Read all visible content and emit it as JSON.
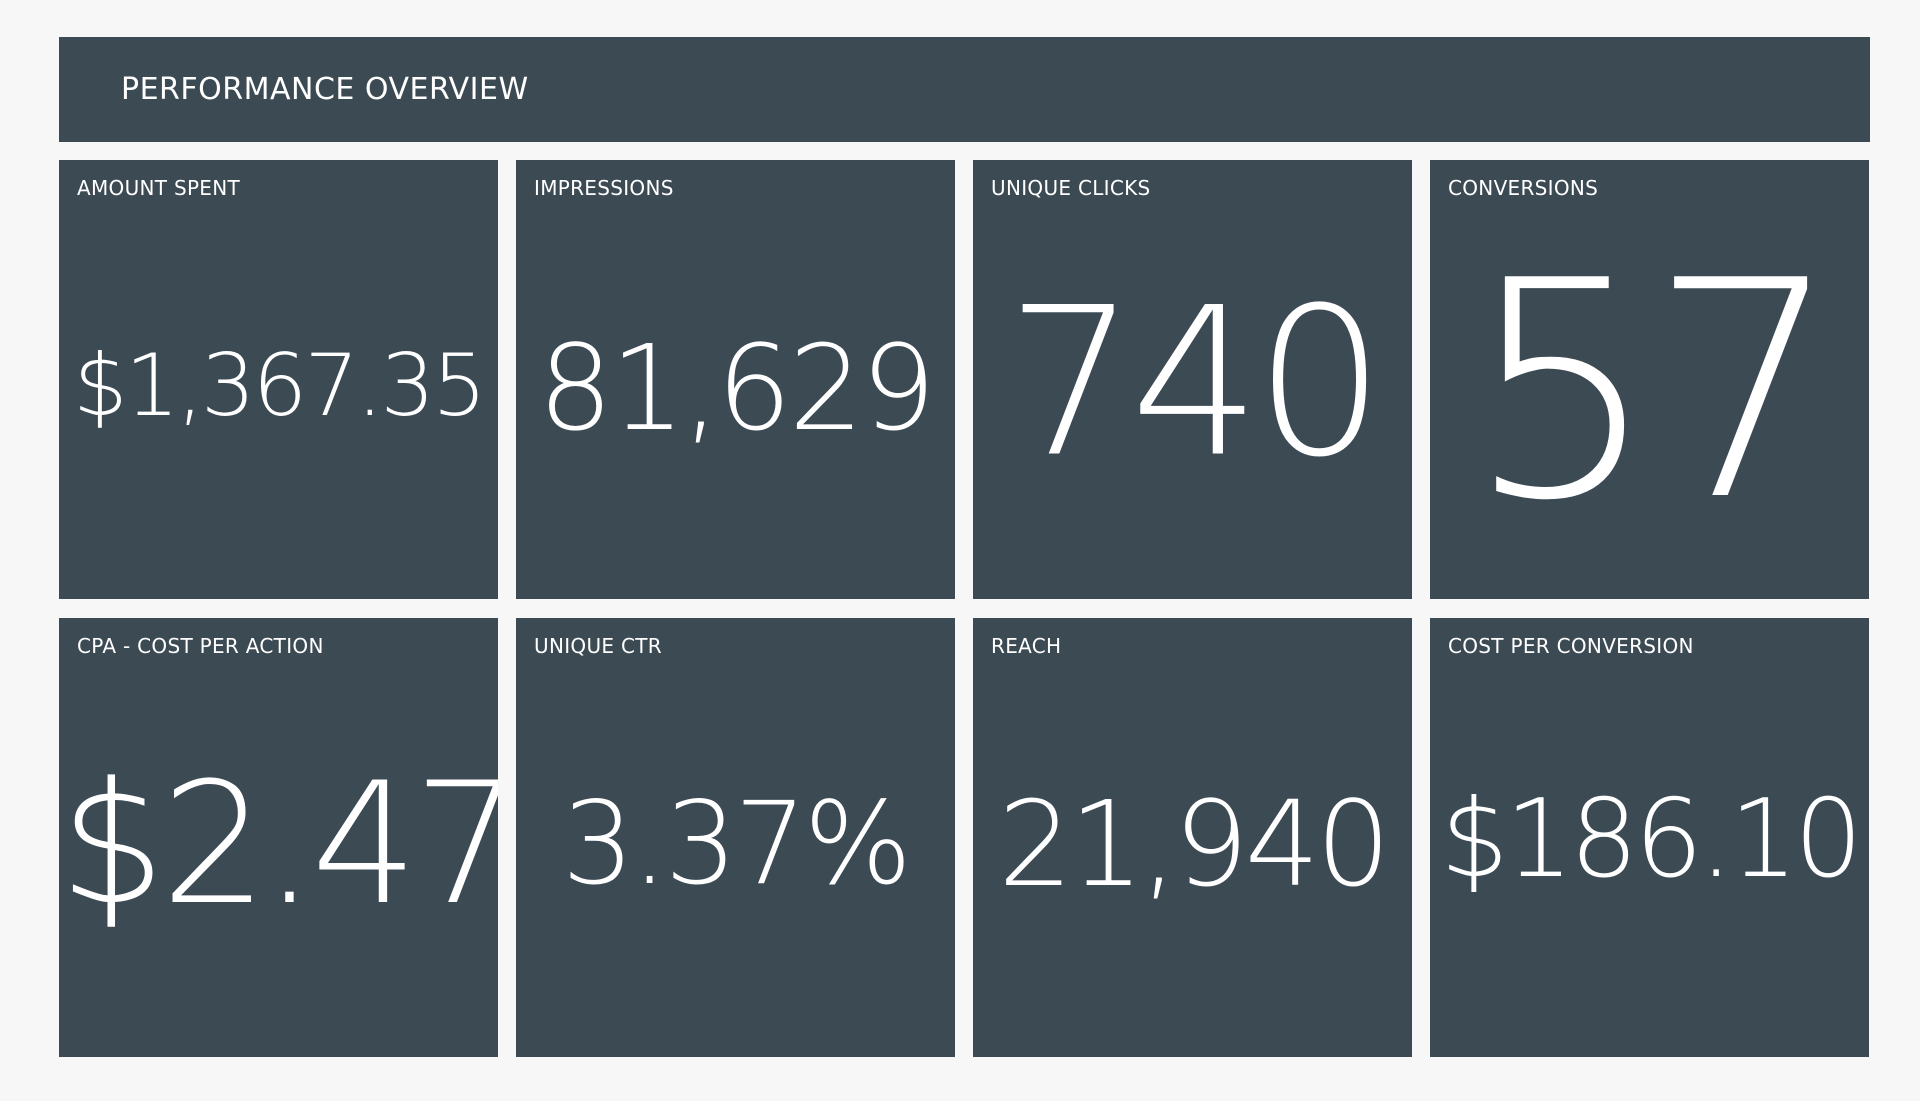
{
  "header": {
    "title": "PERFORMANCE OVERVIEW"
  },
  "colors": {
    "page_background": "#f7f7f7",
    "tile_background": "#3c4a54",
    "text": "#ffffff"
  },
  "tiles": [
    {
      "label": "AMOUNT SPENT",
      "value": "$1,367.35"
    },
    {
      "label": "IMPRESSIONS",
      "value": "81,629"
    },
    {
      "label": "UNIQUE CLICKS",
      "value": "740"
    },
    {
      "label": "CONVERSIONS",
      "value": "57"
    },
    {
      "label": "CPA - COST PER ACTION",
      "value": "$2.47"
    },
    {
      "label": "UNIQUE CTR",
      "value": "3.37%"
    },
    {
      "label": "REACH",
      "value": "21,940"
    },
    {
      "label": "COST PER CONVERSION",
      "value": "$186.10"
    }
  ]
}
